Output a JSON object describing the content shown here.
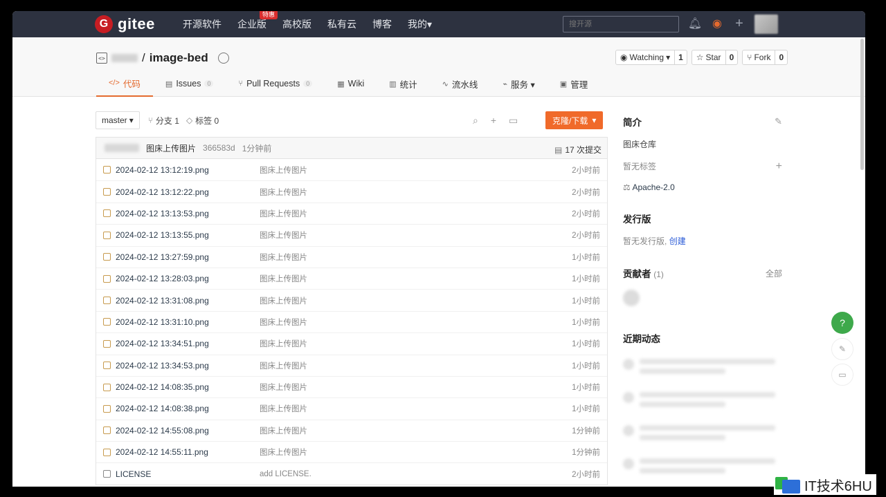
{
  "topbar": {
    "logo_letter": "G",
    "logo_text": "gitee",
    "nav": [
      {
        "label": "开源软件"
      },
      {
        "label": "企业版",
        "badge": "特惠"
      },
      {
        "label": "高校版"
      },
      {
        "label": "私有云"
      },
      {
        "label": "博客"
      },
      {
        "label": "我的▾"
      }
    ],
    "search_placeholder": "搜开源"
  },
  "repo": {
    "name": "image-bed",
    "separator": "/",
    "watch": {
      "label": "Watching",
      "count": "1"
    },
    "star": {
      "label": "Star",
      "count": "0"
    },
    "fork": {
      "label": "Fork",
      "count": "0"
    }
  },
  "tabs": [
    {
      "icon": "</>",
      "label": "代码"
    },
    {
      "icon": "▤",
      "label": "Issues",
      "count": "0"
    },
    {
      "icon": "⑂",
      "label": "Pull Requests",
      "count": "0"
    },
    {
      "icon": "▦",
      "label": "Wiki"
    },
    {
      "icon": "▥",
      "label": "统计"
    },
    {
      "icon": "∿",
      "label": "流水线"
    },
    {
      "icon": "⌁",
      "label": "服务 ▾"
    },
    {
      "icon": "▣",
      "label": "管理"
    }
  ],
  "toolbar": {
    "branch": "master",
    "branches": "分支 1",
    "tags": "标签 0",
    "clone": "克隆/下载"
  },
  "commit": {
    "message": "图床上传图片",
    "sha": "366583d",
    "time": "1分钟前",
    "count": "17 次提交"
  },
  "files": [
    {
      "name": "2024-02-12 13:12:19.png",
      "msg": "图床上传图片",
      "time": "2小时前",
      "type": "image"
    },
    {
      "name": "2024-02-12 13:12:22.png",
      "msg": "图床上传图片",
      "time": "2小时前",
      "type": "image"
    },
    {
      "name": "2024-02-12 13:13:53.png",
      "msg": "图床上传图片",
      "time": "2小时前",
      "type": "image"
    },
    {
      "name": "2024-02-12 13:13:55.png",
      "msg": "图床上传图片",
      "time": "2小时前",
      "type": "image"
    },
    {
      "name": "2024-02-12 13:27:59.png",
      "msg": "图床上传图片",
      "time": "1小时前",
      "type": "image"
    },
    {
      "name": "2024-02-12 13:28:03.png",
      "msg": "图床上传图片",
      "time": "1小时前",
      "type": "image"
    },
    {
      "name": "2024-02-12 13:31:08.png",
      "msg": "图床上传图片",
      "time": "1小时前",
      "type": "image"
    },
    {
      "name": "2024-02-12 13:31:10.png",
      "msg": "图床上传图片",
      "time": "1小时前",
      "type": "image"
    },
    {
      "name": "2024-02-12 13:34:51.png",
      "msg": "图床上传图片",
      "time": "1小时前",
      "type": "image"
    },
    {
      "name": "2024-02-12 13:34:53.png",
      "msg": "图床上传图片",
      "time": "1小时前",
      "type": "image"
    },
    {
      "name": "2024-02-12 14:08:35.png",
      "msg": "图床上传图片",
      "time": "1小时前",
      "type": "image"
    },
    {
      "name": "2024-02-12 14:08:38.png",
      "msg": "图床上传图片",
      "time": "1小时前",
      "type": "image"
    },
    {
      "name": "2024-02-12 14:55:08.png",
      "msg": "图床上传图片",
      "time": "1分钟前",
      "type": "image"
    },
    {
      "name": "2024-02-12 14:55:11.png",
      "msg": "图床上传图片",
      "time": "1分钟前",
      "type": "image"
    },
    {
      "name": "LICENSE",
      "msg": "add LICENSE.",
      "time": "2小时前",
      "type": "doc"
    }
  ],
  "sidebar": {
    "intro_title": "简介",
    "intro_text": "图床仓库",
    "no_tags": "暂无标签",
    "license": "Apache-2.0",
    "release_title": "发行版",
    "no_release": "暂无发行版,",
    "create": "创建",
    "contrib_title": "贡献者",
    "contrib_count": "(1)",
    "all": "全部",
    "activity_title": "近期动态"
  },
  "float": {
    "help": "?"
  },
  "watermark": "IT技术6HU"
}
